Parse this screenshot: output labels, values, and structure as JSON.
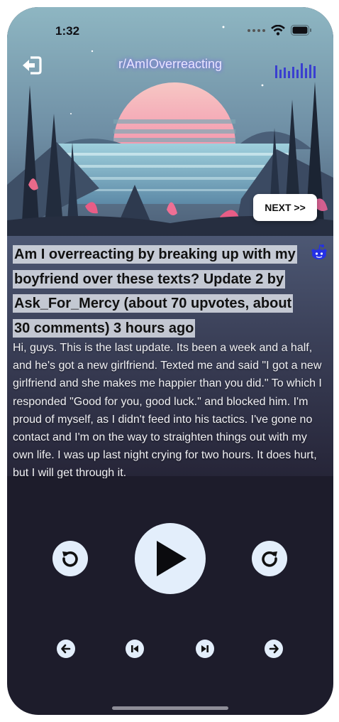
{
  "status_bar": {
    "time": "1:32"
  },
  "header": {
    "subreddit": "r/AmIOverreacting",
    "next_label": "NEXT >>"
  },
  "post": {
    "title": "Am I overreacting by breaking up with my boyfriend over these texts? Update 2 by Ask_For_Mercy (about 70 upvotes, about 30 comments) 3 hours ago",
    "body": "Hi, guys. This is the last update. Its been a week and a half, and he's got a new girlfriend. Texted me and said \"I got a new girlfriend and she makes me happier than you did.\" To which I responded \"Good for you, good luck.\" and blocked him. I'm proud of myself, as I didn't feed into his tactics. I've gone no contact and I'm on the way to straighten things out with my own life. I was up last night crying for two hours. It does hurt, but I will get through it."
  },
  "controls": {
    "icons": [
      "rewind-icon",
      "play-icon",
      "forward-icon",
      "arrow-left-icon",
      "skip-previous-icon",
      "skip-next-icon",
      "arrow-right-icon"
    ]
  },
  "colors": {
    "app_background": "#1d1c2b",
    "control_button": "#e3eefb",
    "title_highlight": "#e1e4ec",
    "sun_top": "#f7b3c4",
    "sky": "#7fa6b4"
  }
}
